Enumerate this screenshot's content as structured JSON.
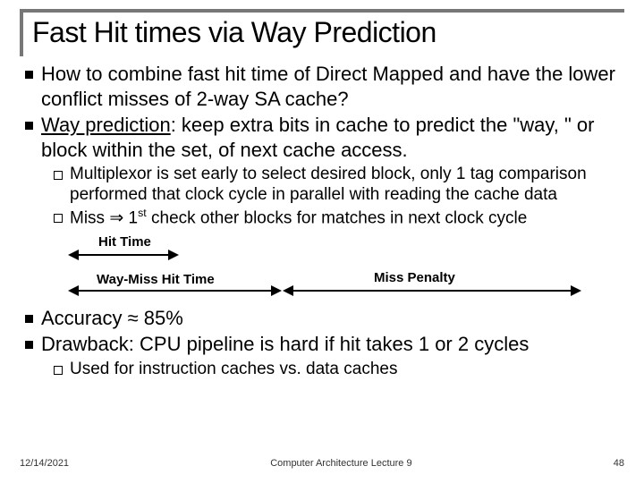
{
  "title": "Fast Hit times via Way Prediction",
  "bullets": {
    "q": "How to combine fast hit time of Direct Mapped and have the lower conflict misses of 2-way SA cache?",
    "wp_lead": "Way prediction",
    "wp_rest": ": keep extra bits in cache to predict the \"way, \" or block within the set, of next cache access.",
    "sub_mux": "Multiplexor is set early to select desired block, only 1 tag comparison performed that clock cycle in parallel with reading the cache data",
    "sub_miss_a": "Miss ",
    "sub_miss_b": " 1",
    "sub_miss_c": "st",
    "sub_miss_d": " check other blocks for matches in next clock cycle",
    "acc_a": "Accuracy ",
    "acc_b": " 85%",
    "drawback": "Drawback: CPU pipeline is hard if hit takes 1 or 2 cycles",
    "sub_used": "Used for instruction caches vs. data caches"
  },
  "symbols": {
    "implies": "⇒",
    "approx": "≈"
  },
  "diagram": {
    "hit_time": "Hit Time",
    "way_miss": "Way-Miss Hit Time",
    "miss_penalty": "Miss Penalty"
  },
  "footer": {
    "date": "12/14/2021",
    "center": "Computer Architecture Lecture 9",
    "page": "48"
  }
}
